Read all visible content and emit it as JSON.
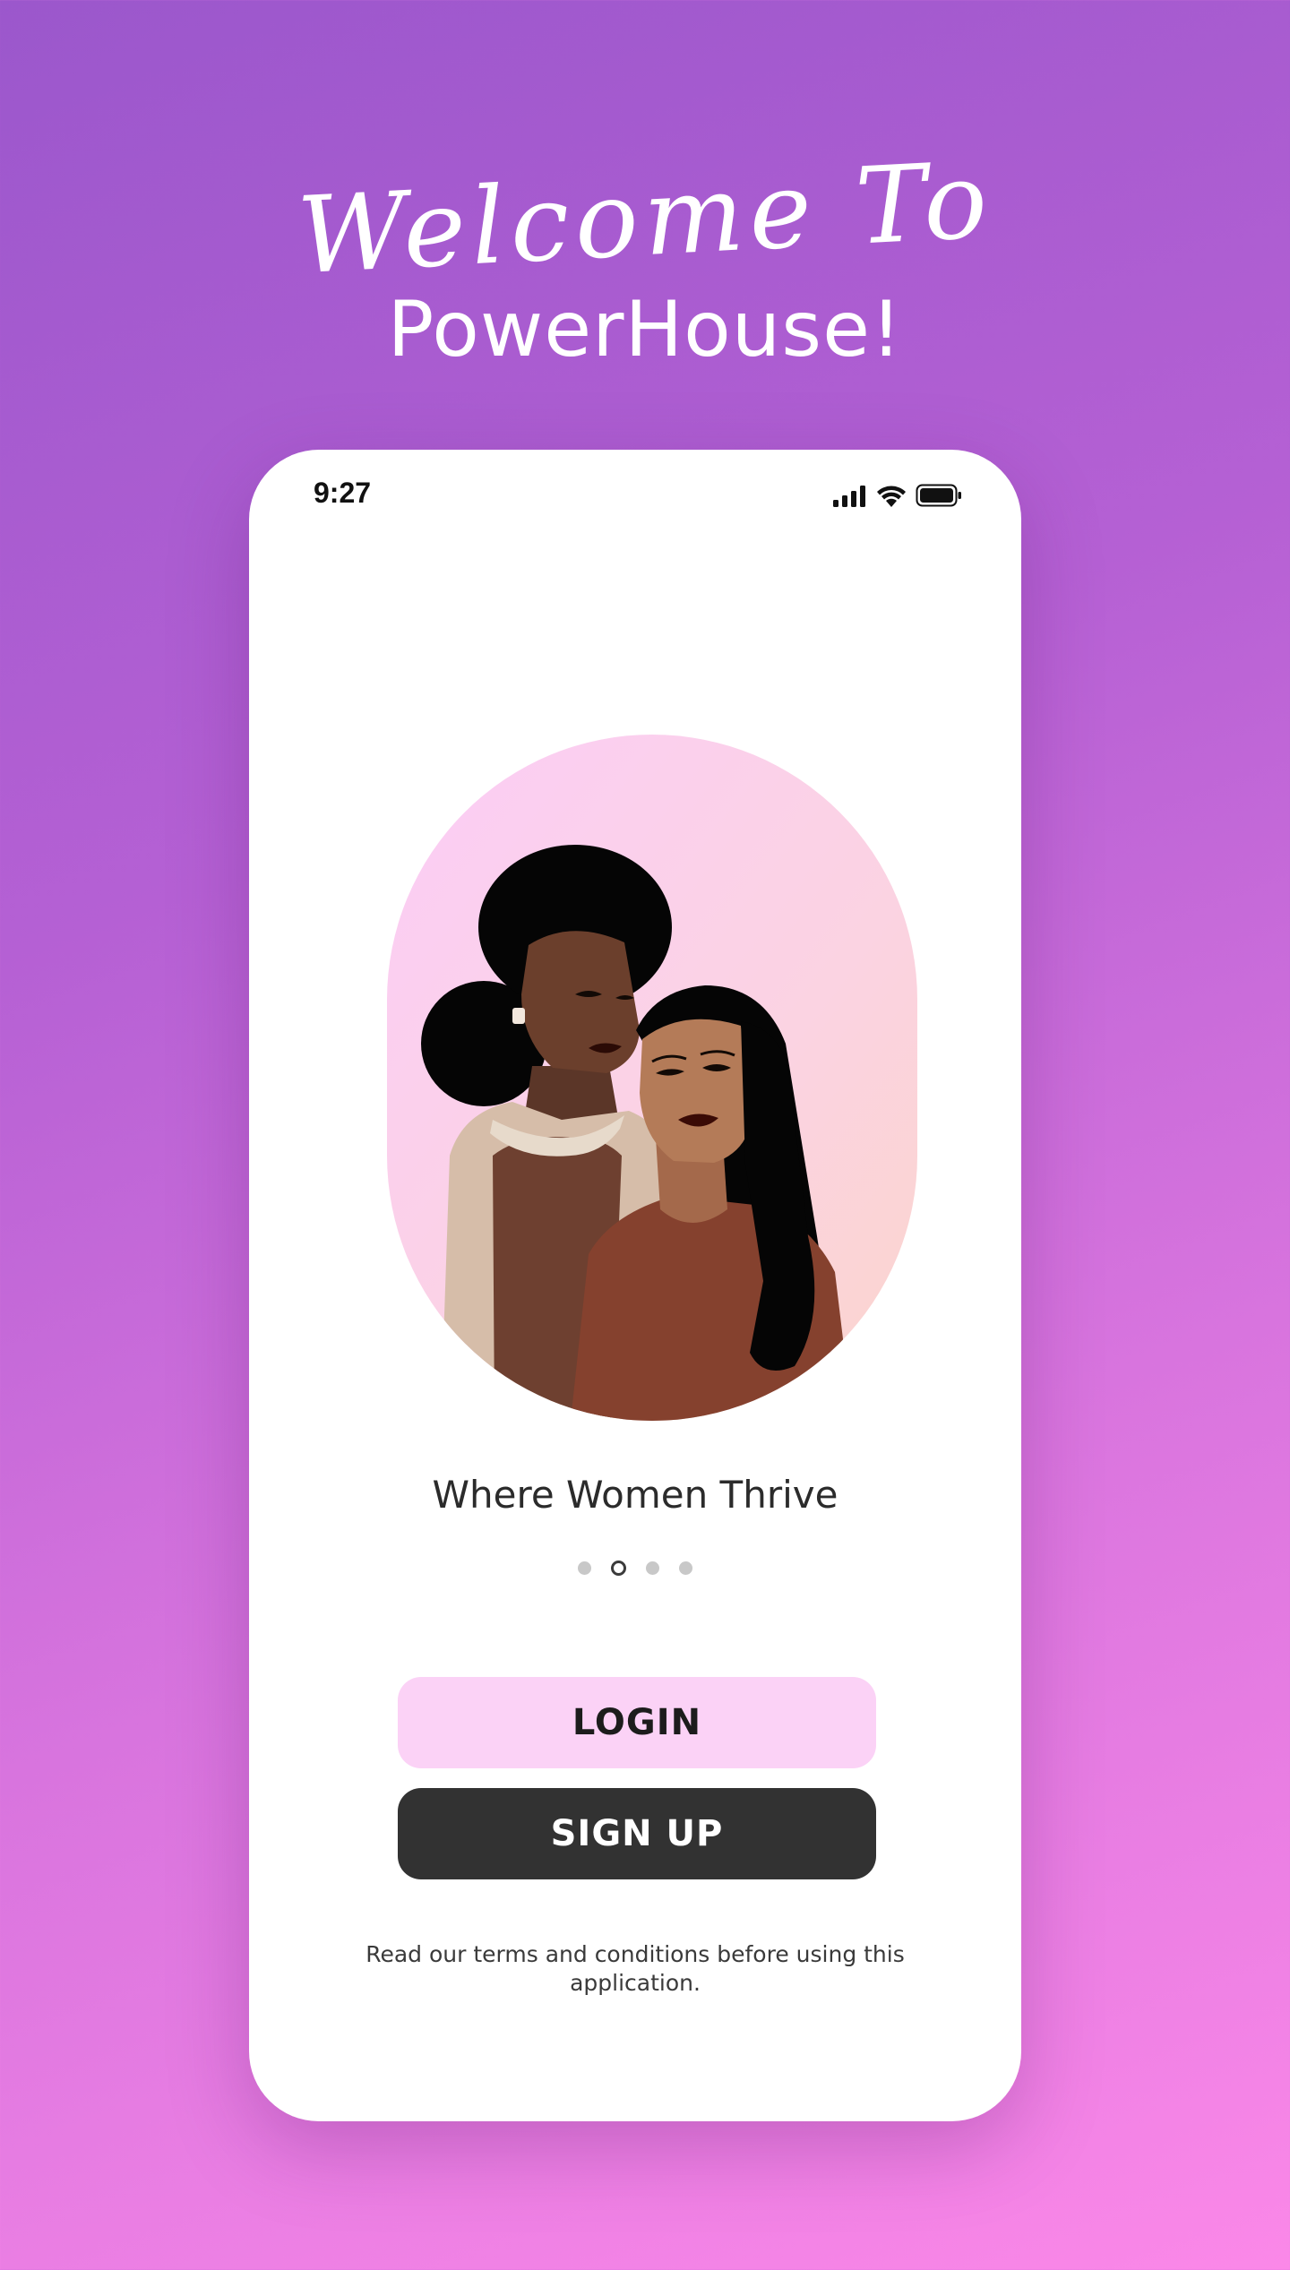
{
  "header": {
    "script_line": "Welcome To",
    "brand": "PowerHouse!"
  },
  "status_bar": {
    "time": "9:27",
    "icons": [
      "cellular-signal-icon",
      "wifi-icon",
      "battery-icon"
    ]
  },
  "onboarding": {
    "illustration": "two-women-illustration",
    "tagline": "Where Women Thrive",
    "pager": {
      "total_pages": 4,
      "active_page": 2
    }
  },
  "actions": {
    "login_label": "LOGIN",
    "signup_label": "SIGN UP"
  },
  "footer": {
    "terms_text": "Read our terms and conditions before using this application."
  },
  "colors": {
    "background_start": "#9b57cc",
    "background_end": "#fb88e8",
    "login_button": "#fbd2f6",
    "signup_button": "#323232",
    "phone_background": "#ffffff"
  }
}
